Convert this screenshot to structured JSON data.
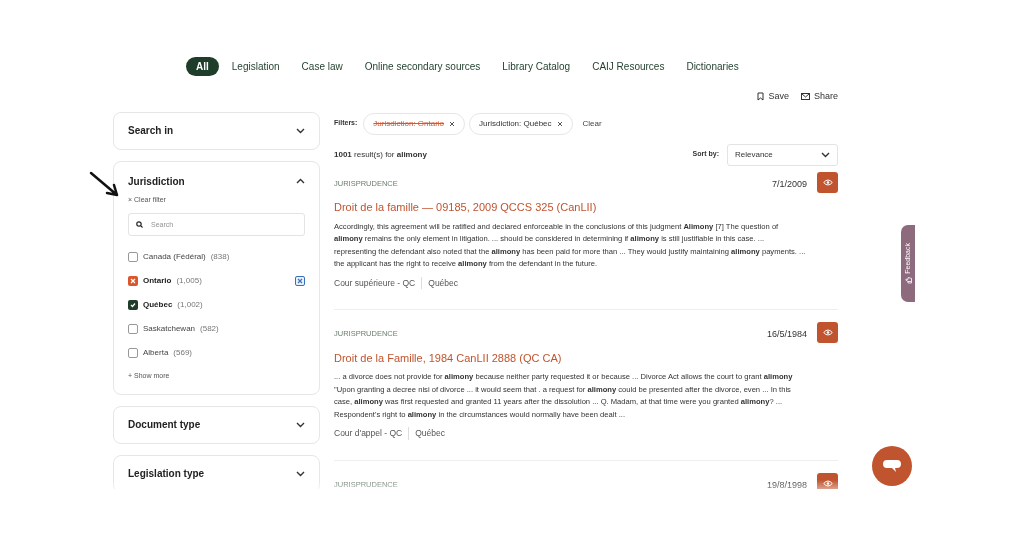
{
  "tabs": [
    {
      "label": "All",
      "selected": true
    },
    {
      "label": "Legislation",
      "selected": false
    },
    {
      "label": "Case law",
      "selected": false
    },
    {
      "label": "Online secondary sources",
      "selected": false
    },
    {
      "label": "Library Catalog",
      "selected": false
    },
    {
      "label": "CAIJ Resources",
      "selected": false
    },
    {
      "label": "Dictionaries",
      "selected": false
    }
  ],
  "actions": [
    {
      "kind": "save",
      "label": "Save"
    },
    {
      "kind": "share",
      "label": "Share"
    }
  ],
  "sidebar": {
    "sections": [
      {
        "title": "Search in",
        "expanded": false
      },
      {
        "title": "Jurisdiction",
        "expanded": true,
        "clear_filter": "× Clear filter",
        "search_placeholder": "Search",
        "options": [
          {
            "name": "Canada (Fédéral)",
            "count": "(838)",
            "checked": false,
            "excluded": false,
            "hovered": false
          },
          {
            "name": "Ontario",
            "count": "(1,005)",
            "checked": false,
            "excluded": true,
            "hovered": true
          },
          {
            "name": "Québec",
            "count": "(1,002)",
            "checked": true,
            "excluded": false,
            "hovered": false
          },
          {
            "name": "Saskatchewan",
            "count": "(582)",
            "checked": false,
            "excluded": false,
            "hovered": false
          },
          {
            "name": "Alberta",
            "count": "(569)",
            "checked": false,
            "excluded": false,
            "hovered": false
          }
        ],
        "show_more": "+ Show more"
      },
      {
        "title": "Document type",
        "expanded": false
      },
      {
        "title": "Legislation type",
        "expanded": false
      }
    ]
  },
  "filters": {
    "label": "Filters:",
    "chips": [
      {
        "label": "Jurisdiction: Ontario",
        "excluded": true
      },
      {
        "label": "Jurisdiction: Québec",
        "excluded": false
      }
    ],
    "clear": "Clear"
  },
  "results_count": "**1001** result(s) for **alimony**",
  "sort": {
    "label": "Sort by:",
    "value": "Relevance"
  },
  "results": [
    {
      "category": "JURISPRUDENCE",
      "date": "7/1/2009",
      "title": "Droit de la famille — 09185, 2009 QCCS 325 (CanLII)",
      "snippet": "Accordingly, this agreement will be ratified and declared enforceable in the conclusions of this judgment **Alimony** [7] The question of **alimony** remains the only element in litigation. ... should be considered in determining if **alimony** is still justifiable in this case. ... representing the defendant also noted that the **alimony** has been paid for more than ... They would justify maintaining **alimony** payments. ... the applicant has the right to receive **alimony** from the defendant in the future.",
      "court": "Cour supérieure - QC",
      "jurisdiction": "Québec"
    },
    {
      "category": "JURISPRUDENCE",
      "date": "16/5/1984",
      "title": "Droit de la Famille, 1984 CanLII 2888 (QC CA)",
      "snippet": "... a divorce does not provide for **alimony** because neither party requested it or because ... Divorce Act allows the court to grant **alimony** \"Upon granting a decree nisi of divorce ... it would seem that . a request for **alimony** could be presented after the divorce, even ... In this case, **alimony** was first requested and granted 11 years after the dissolution ... Q. Madam, at that time were you granted **alimony**? ... Respondent's right to **alimony** in the circumstances would normally have been dealt ...",
      "court": "Cour d'appel - QC",
      "jurisdiction": "Québec"
    },
    {
      "category": "JURISPRUDENCE",
      "date": "19/8/1998"
    }
  ],
  "feedback": {
    "label": "Feedback"
  }
}
